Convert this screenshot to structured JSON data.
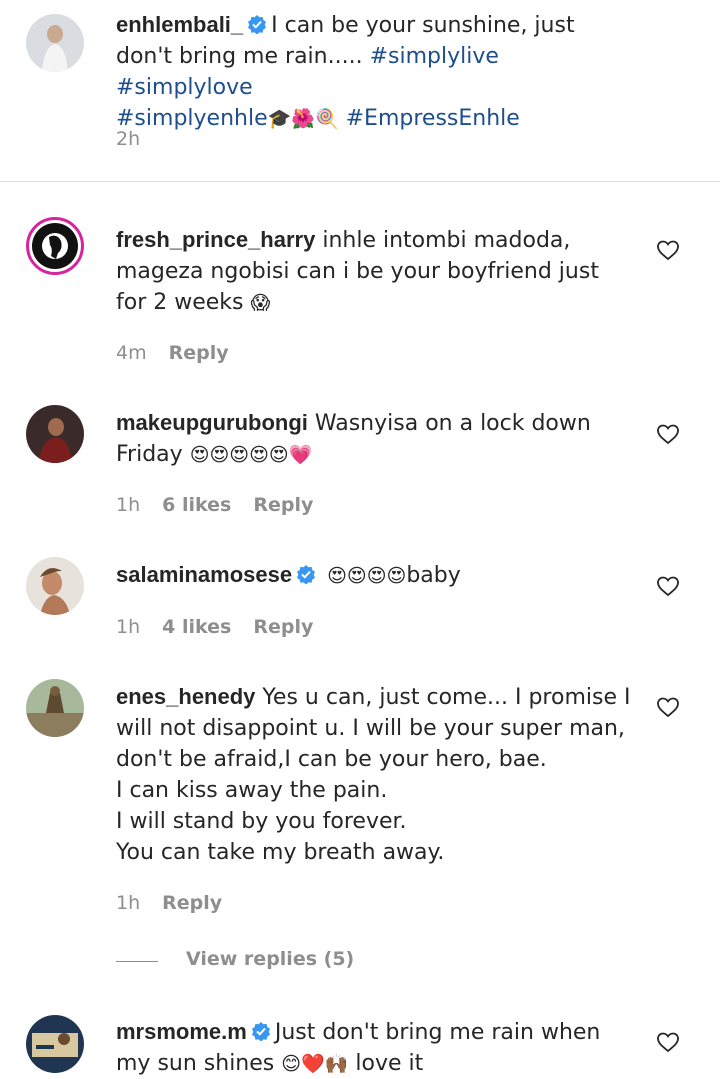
{
  "post": {
    "username": "enhlembali_",
    "caption": "I can be your sunshine, just don't bring me rain.....",
    "tags": [
      "#simplylive",
      "#simplylove",
      "#simplyenhle"
    ],
    "tag_end": "#EmpressEnhle",
    "time": "2h"
  },
  "comments": [
    {
      "username": "fresh_prince_harry",
      "text": "inhle intombi madoda, mageza ngobisi can i be your boyfriend just for 2 weeks",
      "time": "4m",
      "likes": "",
      "reply": "Reply"
    },
    {
      "username": "makeupgurubongi",
      "text": "Wasnyisa on a lock down Friday",
      "time": "1h",
      "likes": "6 likes",
      "reply": "Reply"
    },
    {
      "username": "salaminamosese",
      "text": "baby",
      "time": "1h",
      "likes": "4 likes",
      "reply": "Reply"
    },
    {
      "username": "enes_henedy",
      "text_lines": [
        "Yes u can, just come... I promise I",
        "will not disappoint u. I will be your super man,",
        "don't be afraid,I can be your hero, bae.",
        "I can kiss away the pain.",
        "I will stand by you forever.",
        "You can take my breath away."
      ],
      "time": "1h",
      "reply": "Reply"
    },
    {
      "username": "mrsmome.m",
      "text": "Just don't bring me rain when my sun shines",
      "text_end": "love it"
    }
  ],
  "view_replies": "View replies (5)",
  "colors": {
    "tag": "#1f4e8c",
    "muted": "#8e8e8e",
    "verified": "#3897f0",
    "story_ring": "#d6249f"
  }
}
